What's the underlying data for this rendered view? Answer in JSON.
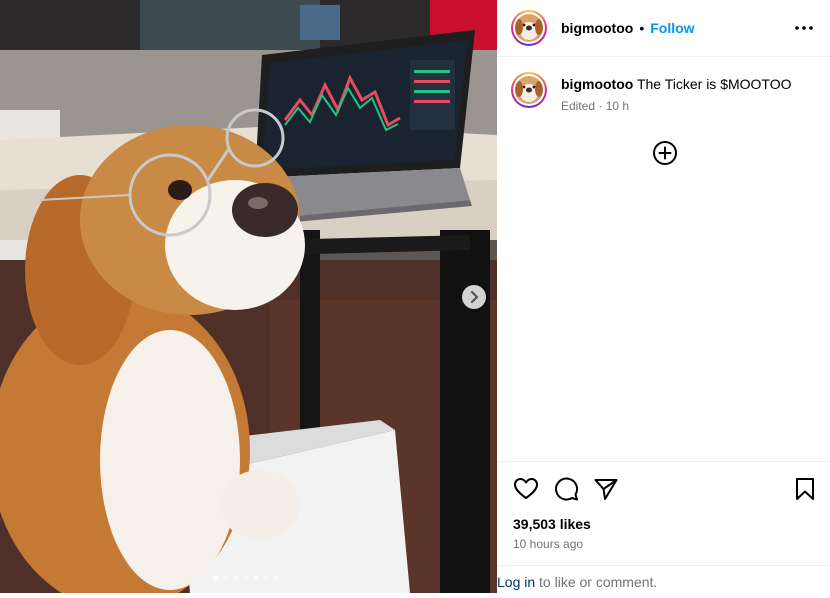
{
  "post": {
    "username": "bigmootoo",
    "separator": "•",
    "follow_label": "Follow",
    "caption": "The Ticker is $MOOTOO",
    "edited_label": "Edited",
    "meta_sep": " · ",
    "edited_time": "10 h",
    "likes": "39,503 likes",
    "time_ago": "10 hours ago",
    "carousel": {
      "slide_count": 7,
      "current_index": 0
    }
  },
  "login": {
    "link_label": "Log in",
    "rest_label": " to like or comment."
  },
  "icons": {
    "more": "more-options-icon",
    "add": "add-circle-icon",
    "like": "heart-icon",
    "comment": "comment-icon",
    "share": "paper-plane-icon",
    "save": "bookmark-icon",
    "next": "chevron-right-icon"
  },
  "colors": {
    "accent": "#0095f6",
    "link": "#00376b",
    "muted": "#737373",
    "divider": "#efefef"
  }
}
